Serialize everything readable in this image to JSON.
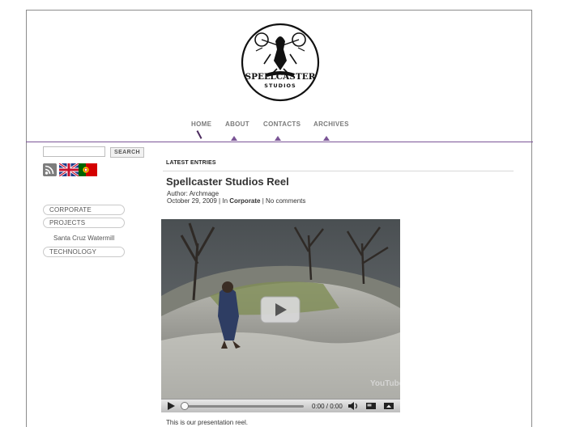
{
  "logo": {
    "line1": "SPELLCASTER",
    "line2": "STUDIOS"
  },
  "nav": [
    {
      "label": "HOME"
    },
    {
      "label": "ABOUT"
    },
    {
      "label": "CONTACTS"
    },
    {
      "label": "ARCHIVES"
    }
  ],
  "sidebar": {
    "search_button": "SEARCH",
    "search_value": "",
    "categories": [
      "CORPORATE",
      "PROJECTS",
      "TECHNOLOGY"
    ],
    "subcategory": "Santa Cruz Watermill"
  },
  "main": {
    "section_title": "LATEST ENTRIES",
    "post": {
      "title": "Spellcaster Studios Reel",
      "author": "Author: Archmage",
      "date": "October 29, 2009",
      "in_label": "In",
      "category": "Corporate",
      "comments": "No comments",
      "body": "This is our presentation reel."
    },
    "video": {
      "time": "0:00 / 0:00",
      "brand": "YouTube"
    }
  },
  "colors": {
    "accent": "#7b5596",
    "nav_text": "#7a7a7a",
    "frame": "#8c8c8c"
  }
}
